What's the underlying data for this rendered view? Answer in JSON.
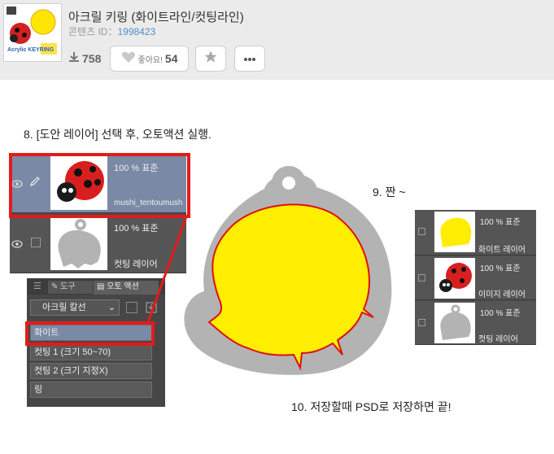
{
  "header": {
    "title": "아크릴 키링 (화이트라인/컷팅라인)",
    "content_id_label": "콘텐츠 ID：",
    "content_id": "1998423",
    "downloads": "758",
    "like_label": "좋아요!",
    "like_count": "54",
    "thumbnail_text": "Acrylic KEYRING"
  },
  "steps": {
    "step8": "8. [도안 레이어] 선택 후, 오토액션 실행.",
    "step9": "9. 짠 ~",
    "step10": "10. 저장할때 PSD로 저장하면 끝!"
  },
  "layer_panel": {
    "layers": [
      {
        "mode": "100 % 표준",
        "name": "mushi_tentoumush"
      },
      {
        "mode": "100 % 표준",
        "name": "컷팅 레이어"
      }
    ]
  },
  "autoaction_panel": {
    "tab_tool": "도구",
    "tab_autoaction": "오토 액션",
    "set_name": "아크릴 칼선",
    "items": [
      "화이트",
      "컷팅 1 (크기 50~70)",
      "컷팅 2 (크기 지정X)",
      "링"
    ]
  },
  "result_panel": {
    "layers": [
      {
        "mode": "100 % 표준",
        "name": "화이트 레이어"
      },
      {
        "mode": "100 % 표준",
        "name": "이미지 레이어"
      },
      {
        "mode": "100 % 표준",
        "name": "컷팅 레이어"
      }
    ]
  },
  "colors": {
    "accent_red": "#e21b1b",
    "fill_yellow": "#ffee00",
    "cut_gray": "#b3b3b3",
    "link_blue": "#4a90c8"
  },
  "icons": [
    "download-icon",
    "heart-icon",
    "star-icon",
    "more-icon",
    "eye-icon",
    "pen-icon",
    "menu-icon"
  ]
}
